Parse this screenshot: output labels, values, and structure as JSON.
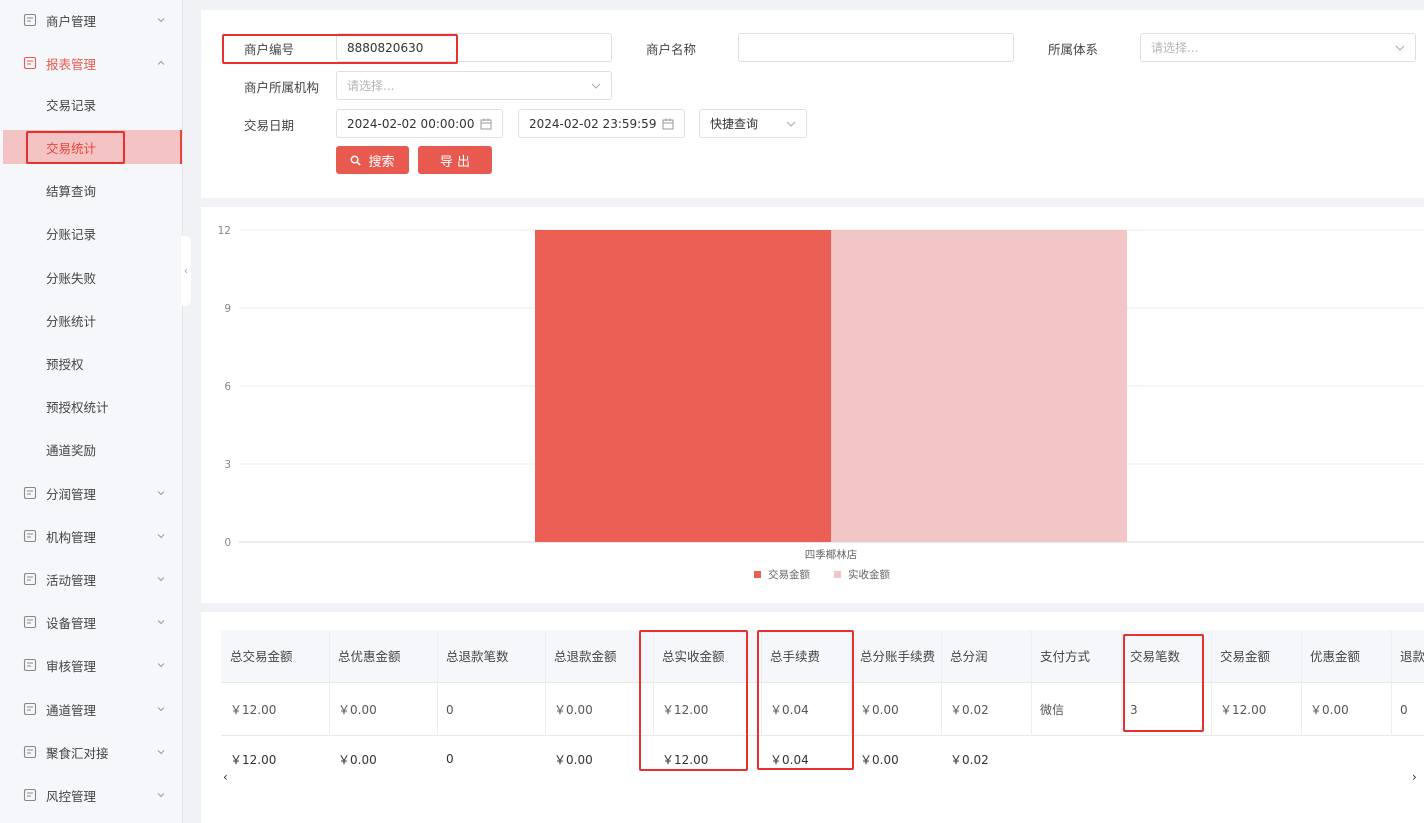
{
  "sidebar": {
    "items": [
      {
        "label": "商户管理",
        "icon": "merchant-icon",
        "type": "group"
      },
      {
        "label": "报表管理",
        "icon": "report-icon",
        "type": "group-open"
      },
      {
        "label": "交易记录",
        "type": "sub"
      },
      {
        "label": "交易统计",
        "type": "sub-active"
      },
      {
        "label": "结算查询",
        "type": "sub"
      },
      {
        "label": "分账记录",
        "type": "sub"
      },
      {
        "label": "分账失败",
        "type": "sub"
      },
      {
        "label": "分账统计",
        "type": "sub"
      },
      {
        "label": "预授权",
        "type": "sub"
      },
      {
        "label": "预授权统计",
        "type": "sub"
      },
      {
        "label": "通道奖励",
        "type": "sub"
      },
      {
        "label": "分润管理",
        "icon": "profit-icon",
        "type": "group"
      },
      {
        "label": "机构管理",
        "icon": "org-icon",
        "type": "group"
      },
      {
        "label": "活动管理",
        "icon": "activity-icon",
        "type": "group"
      },
      {
        "label": "设备管理",
        "icon": "device-icon",
        "type": "group"
      },
      {
        "label": "审核管理",
        "icon": "audit-icon",
        "type": "group"
      },
      {
        "label": "通道管理",
        "icon": "channel-icon",
        "type": "group"
      },
      {
        "label": "聚食汇对接",
        "icon": "connect-icon",
        "type": "group"
      },
      {
        "label": "风控管理",
        "icon": "risk-icon",
        "type": "group"
      }
    ]
  },
  "filter": {
    "merchant_no_label": "商户编号",
    "merchant_no_value": "8880820630",
    "merchant_name_label": "商户名称",
    "merchant_name_value": "",
    "system_label": "所属体系",
    "system_placeholder": "请选择...",
    "org_label": "商户所属机构",
    "org_placeholder": "请选择...",
    "date_label": "交易日期",
    "date_start": "2024-02-02 00:00:00",
    "date_end": "2024-02-02 23:59:59",
    "quick_query": "快捷查询",
    "search_button": "搜索",
    "export_button": "导 出"
  },
  "chart_data": {
    "type": "bar",
    "categories": [
      "四季椰林店"
    ],
    "series": [
      {
        "name": "交易金额",
        "values": [
          12
        ],
        "color": "#ec5f55"
      },
      {
        "name": "实收金额",
        "values": [
          12
        ],
        "color": "#f2c6c6"
      }
    ],
    "yticks": [
      0,
      3,
      6,
      9,
      12
    ],
    "ylim": [
      0,
      12
    ],
    "grid": true,
    "legend": "bottom-center"
  },
  "table": {
    "headers": [
      "总交易金额",
      "总优惠金额",
      "总退款笔数",
      "总退款金额",
      "总实收金额",
      "总手续费",
      "总分账手续费",
      "总分润",
      "支付方式",
      "交易笔数",
      "交易金额",
      "优惠金额",
      "退款"
    ],
    "row": [
      "￥12.00",
      "￥0.00",
      "0",
      "￥0.00",
      "￥12.00",
      "￥0.04",
      "￥0.00",
      "￥0.02",
      "微信",
      "3",
      "￥12.00",
      "￥0.00",
      "0"
    ],
    "footer": [
      "￥12.00",
      "￥0.00",
      "0",
      "￥0.00",
      "￥12.00",
      "￥0.04",
      "￥0.00",
      "￥0.02"
    ],
    "scroll_left": "‹",
    "scroll_right": "›"
  },
  "colors": {
    "accent": "#e85a50",
    "highlight_box": "#e8302f"
  }
}
